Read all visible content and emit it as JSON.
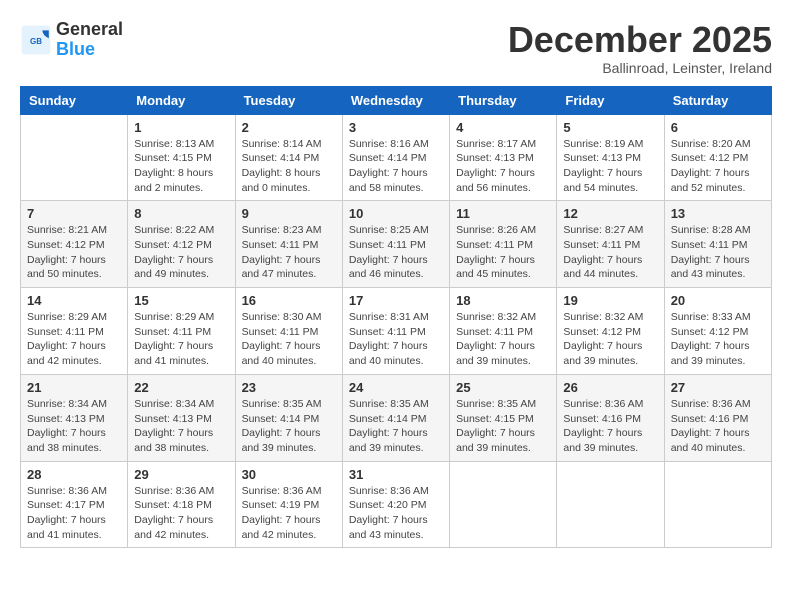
{
  "header": {
    "logo": {
      "line1": "General",
      "line2": "Blue"
    },
    "title": "December 2025",
    "location": "Ballinroad, Leinster, Ireland"
  },
  "days_of_week": [
    "Sunday",
    "Monday",
    "Tuesday",
    "Wednesday",
    "Thursday",
    "Friday",
    "Saturday"
  ],
  "weeks": [
    {
      "days": [
        {
          "number": "",
          "info": ""
        },
        {
          "number": "1",
          "info": "Sunrise: 8:13 AM\nSunset: 4:15 PM\nDaylight: 8 hours\nand 2 minutes."
        },
        {
          "number": "2",
          "info": "Sunrise: 8:14 AM\nSunset: 4:14 PM\nDaylight: 8 hours\nand 0 minutes."
        },
        {
          "number": "3",
          "info": "Sunrise: 8:16 AM\nSunset: 4:14 PM\nDaylight: 7 hours\nand 58 minutes."
        },
        {
          "number": "4",
          "info": "Sunrise: 8:17 AM\nSunset: 4:13 PM\nDaylight: 7 hours\nand 56 minutes."
        },
        {
          "number": "5",
          "info": "Sunrise: 8:19 AM\nSunset: 4:13 PM\nDaylight: 7 hours\nand 54 minutes."
        },
        {
          "number": "6",
          "info": "Sunrise: 8:20 AM\nSunset: 4:12 PM\nDaylight: 7 hours\nand 52 minutes."
        }
      ]
    },
    {
      "days": [
        {
          "number": "7",
          "info": "Sunrise: 8:21 AM\nSunset: 4:12 PM\nDaylight: 7 hours\nand 50 minutes."
        },
        {
          "number": "8",
          "info": "Sunrise: 8:22 AM\nSunset: 4:12 PM\nDaylight: 7 hours\nand 49 minutes."
        },
        {
          "number": "9",
          "info": "Sunrise: 8:23 AM\nSunset: 4:11 PM\nDaylight: 7 hours\nand 47 minutes."
        },
        {
          "number": "10",
          "info": "Sunrise: 8:25 AM\nSunset: 4:11 PM\nDaylight: 7 hours\nand 46 minutes."
        },
        {
          "number": "11",
          "info": "Sunrise: 8:26 AM\nSunset: 4:11 PM\nDaylight: 7 hours\nand 45 minutes."
        },
        {
          "number": "12",
          "info": "Sunrise: 8:27 AM\nSunset: 4:11 PM\nDaylight: 7 hours\nand 44 minutes."
        },
        {
          "number": "13",
          "info": "Sunrise: 8:28 AM\nSunset: 4:11 PM\nDaylight: 7 hours\nand 43 minutes."
        }
      ]
    },
    {
      "days": [
        {
          "number": "14",
          "info": "Sunrise: 8:29 AM\nSunset: 4:11 PM\nDaylight: 7 hours\nand 42 minutes."
        },
        {
          "number": "15",
          "info": "Sunrise: 8:29 AM\nSunset: 4:11 PM\nDaylight: 7 hours\nand 41 minutes."
        },
        {
          "number": "16",
          "info": "Sunrise: 8:30 AM\nSunset: 4:11 PM\nDaylight: 7 hours\nand 40 minutes."
        },
        {
          "number": "17",
          "info": "Sunrise: 8:31 AM\nSunset: 4:11 PM\nDaylight: 7 hours\nand 40 minutes."
        },
        {
          "number": "18",
          "info": "Sunrise: 8:32 AM\nSunset: 4:11 PM\nDaylight: 7 hours\nand 39 minutes."
        },
        {
          "number": "19",
          "info": "Sunrise: 8:32 AM\nSunset: 4:12 PM\nDaylight: 7 hours\nand 39 minutes."
        },
        {
          "number": "20",
          "info": "Sunrise: 8:33 AM\nSunset: 4:12 PM\nDaylight: 7 hours\nand 39 minutes."
        }
      ]
    },
    {
      "days": [
        {
          "number": "21",
          "info": "Sunrise: 8:34 AM\nSunset: 4:13 PM\nDaylight: 7 hours\nand 38 minutes."
        },
        {
          "number": "22",
          "info": "Sunrise: 8:34 AM\nSunset: 4:13 PM\nDaylight: 7 hours\nand 38 minutes."
        },
        {
          "number": "23",
          "info": "Sunrise: 8:35 AM\nSunset: 4:14 PM\nDaylight: 7 hours\nand 39 minutes."
        },
        {
          "number": "24",
          "info": "Sunrise: 8:35 AM\nSunset: 4:14 PM\nDaylight: 7 hours\nand 39 minutes."
        },
        {
          "number": "25",
          "info": "Sunrise: 8:35 AM\nSunset: 4:15 PM\nDaylight: 7 hours\nand 39 minutes."
        },
        {
          "number": "26",
          "info": "Sunrise: 8:36 AM\nSunset: 4:16 PM\nDaylight: 7 hours\nand 39 minutes."
        },
        {
          "number": "27",
          "info": "Sunrise: 8:36 AM\nSunset: 4:16 PM\nDaylight: 7 hours\nand 40 minutes."
        }
      ]
    },
    {
      "days": [
        {
          "number": "28",
          "info": "Sunrise: 8:36 AM\nSunset: 4:17 PM\nDaylight: 7 hours\nand 41 minutes."
        },
        {
          "number": "29",
          "info": "Sunrise: 8:36 AM\nSunset: 4:18 PM\nDaylight: 7 hours\nand 42 minutes."
        },
        {
          "number": "30",
          "info": "Sunrise: 8:36 AM\nSunset: 4:19 PM\nDaylight: 7 hours\nand 42 minutes."
        },
        {
          "number": "31",
          "info": "Sunrise: 8:36 AM\nSunset: 4:20 PM\nDaylight: 7 hours\nand 43 minutes."
        },
        {
          "number": "",
          "info": ""
        },
        {
          "number": "",
          "info": ""
        },
        {
          "number": "",
          "info": ""
        }
      ]
    }
  ]
}
